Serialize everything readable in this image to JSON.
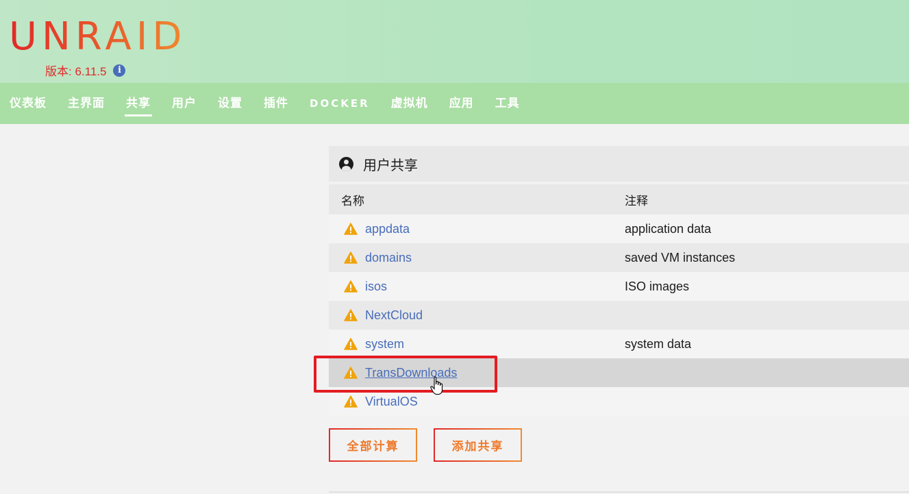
{
  "header": {
    "logo": "UNRAID",
    "version": "版本: 6.11.5",
    "colors": {
      "logo_start": "#e22828",
      "logo_end": "#ef8a2f",
      "header_bg": "#b9e5c2",
      "nav_bg": "#a9dea4"
    }
  },
  "nav": {
    "items": [
      {
        "label": "仪表板"
      },
      {
        "label": "主界面"
      },
      {
        "label": "共享",
        "active": true
      },
      {
        "label": "用户"
      },
      {
        "label": "设置"
      },
      {
        "label": "插件"
      },
      {
        "label": "DOCKER"
      },
      {
        "label": "虚拟机"
      },
      {
        "label": "应用"
      },
      {
        "label": "工具"
      }
    ]
  },
  "panel": {
    "title": "用户共享",
    "title_icon": "user-circle-icon",
    "columns": {
      "name": "名称",
      "comment": "注释"
    },
    "shares": [
      {
        "name": "appdata",
        "comment": "application data",
        "status_icon": "warning-icon"
      },
      {
        "name": "domains",
        "comment": "saved VM instances",
        "status_icon": "warning-icon"
      },
      {
        "name": "isos",
        "comment": "ISO images",
        "status_icon": "warning-icon"
      },
      {
        "name": "NextCloud",
        "comment": "",
        "status_icon": "warning-icon"
      },
      {
        "name": "system",
        "comment": "system data",
        "status_icon": "warning-icon"
      },
      {
        "name": "TransDownloads",
        "comment": "",
        "status_icon": "warning-icon",
        "hovered": true
      },
      {
        "name": "VirtualOS",
        "comment": "",
        "status_icon": "warning-icon"
      }
    ]
  },
  "buttons": {
    "compute_all": "全部计算",
    "add_share": "添加共享"
  },
  "colors": {
    "link": "#486dba",
    "warning": "#f0a30a",
    "highlight_box": "#e31c23"
  }
}
